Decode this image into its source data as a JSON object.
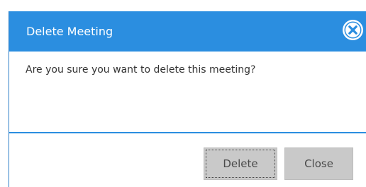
{
  "dialog": {
    "title": "Delete Meeting",
    "message": "Are you sure you want to delete this meeting?",
    "buttons": {
      "delete_label": "Delete",
      "close_label": "Close"
    },
    "close_icon": "close-circle-icon"
  },
  "colors": {
    "titlebar": "#2b8ee0",
    "title_text": "#ffffff",
    "button_bg": "#c9c9c9",
    "button_text": "#4a4a4a",
    "separator": "#2b8ee0"
  }
}
